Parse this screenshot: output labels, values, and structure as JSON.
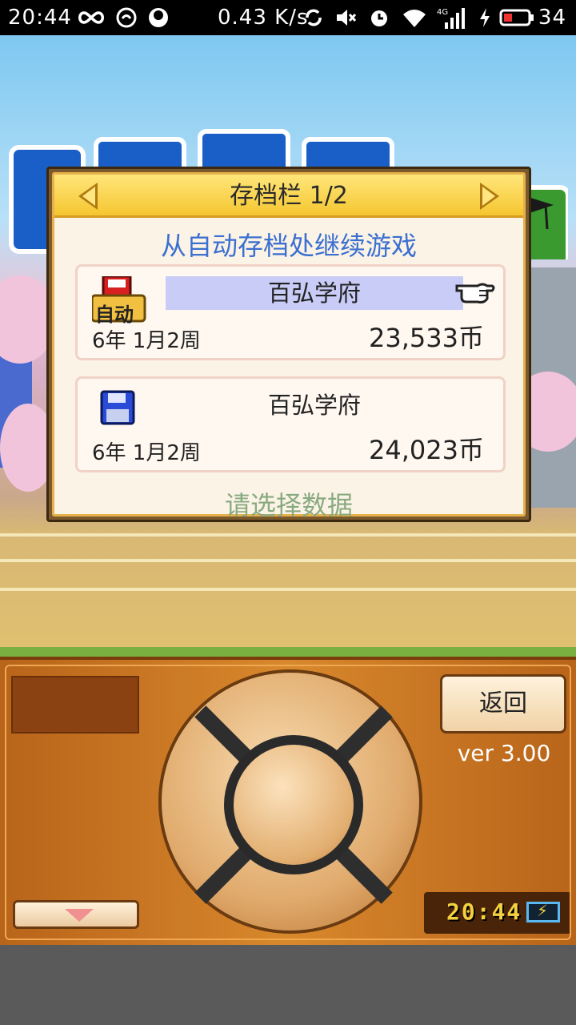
{
  "status_bar": {
    "time": "20:44",
    "net_speed": "0.43 K/s",
    "battery": "34",
    "icons": [
      "infinity-icon",
      "qq-icon",
      "app-icon",
      "sync-icon",
      "mute-icon",
      "alarm-icon",
      "wifi-icon",
      "signal-4g-icon",
      "charging-icon",
      "battery-icon"
    ]
  },
  "dialog": {
    "title": "存档栏 1/2",
    "continue_label": "从自动存档处继续游戏",
    "select_prompt": "请选择数据",
    "slots": [
      {
        "badge": "自动",
        "name": "百弘学府",
        "date": "6年 1月2周",
        "money": "23,533币",
        "selected": true
      },
      {
        "name": "百弘学府",
        "date": "6年 1月2周",
        "money": "24,023币",
        "selected": false
      }
    ]
  },
  "controller": {
    "back_label": "返回",
    "version": "ver 3.00",
    "clock": "20:44"
  },
  "colors": {
    "dialog_header": "#f5c630",
    "continue_text": "#3b6fd0",
    "select_prompt": "#88aa80",
    "panel": "#d8882c"
  }
}
